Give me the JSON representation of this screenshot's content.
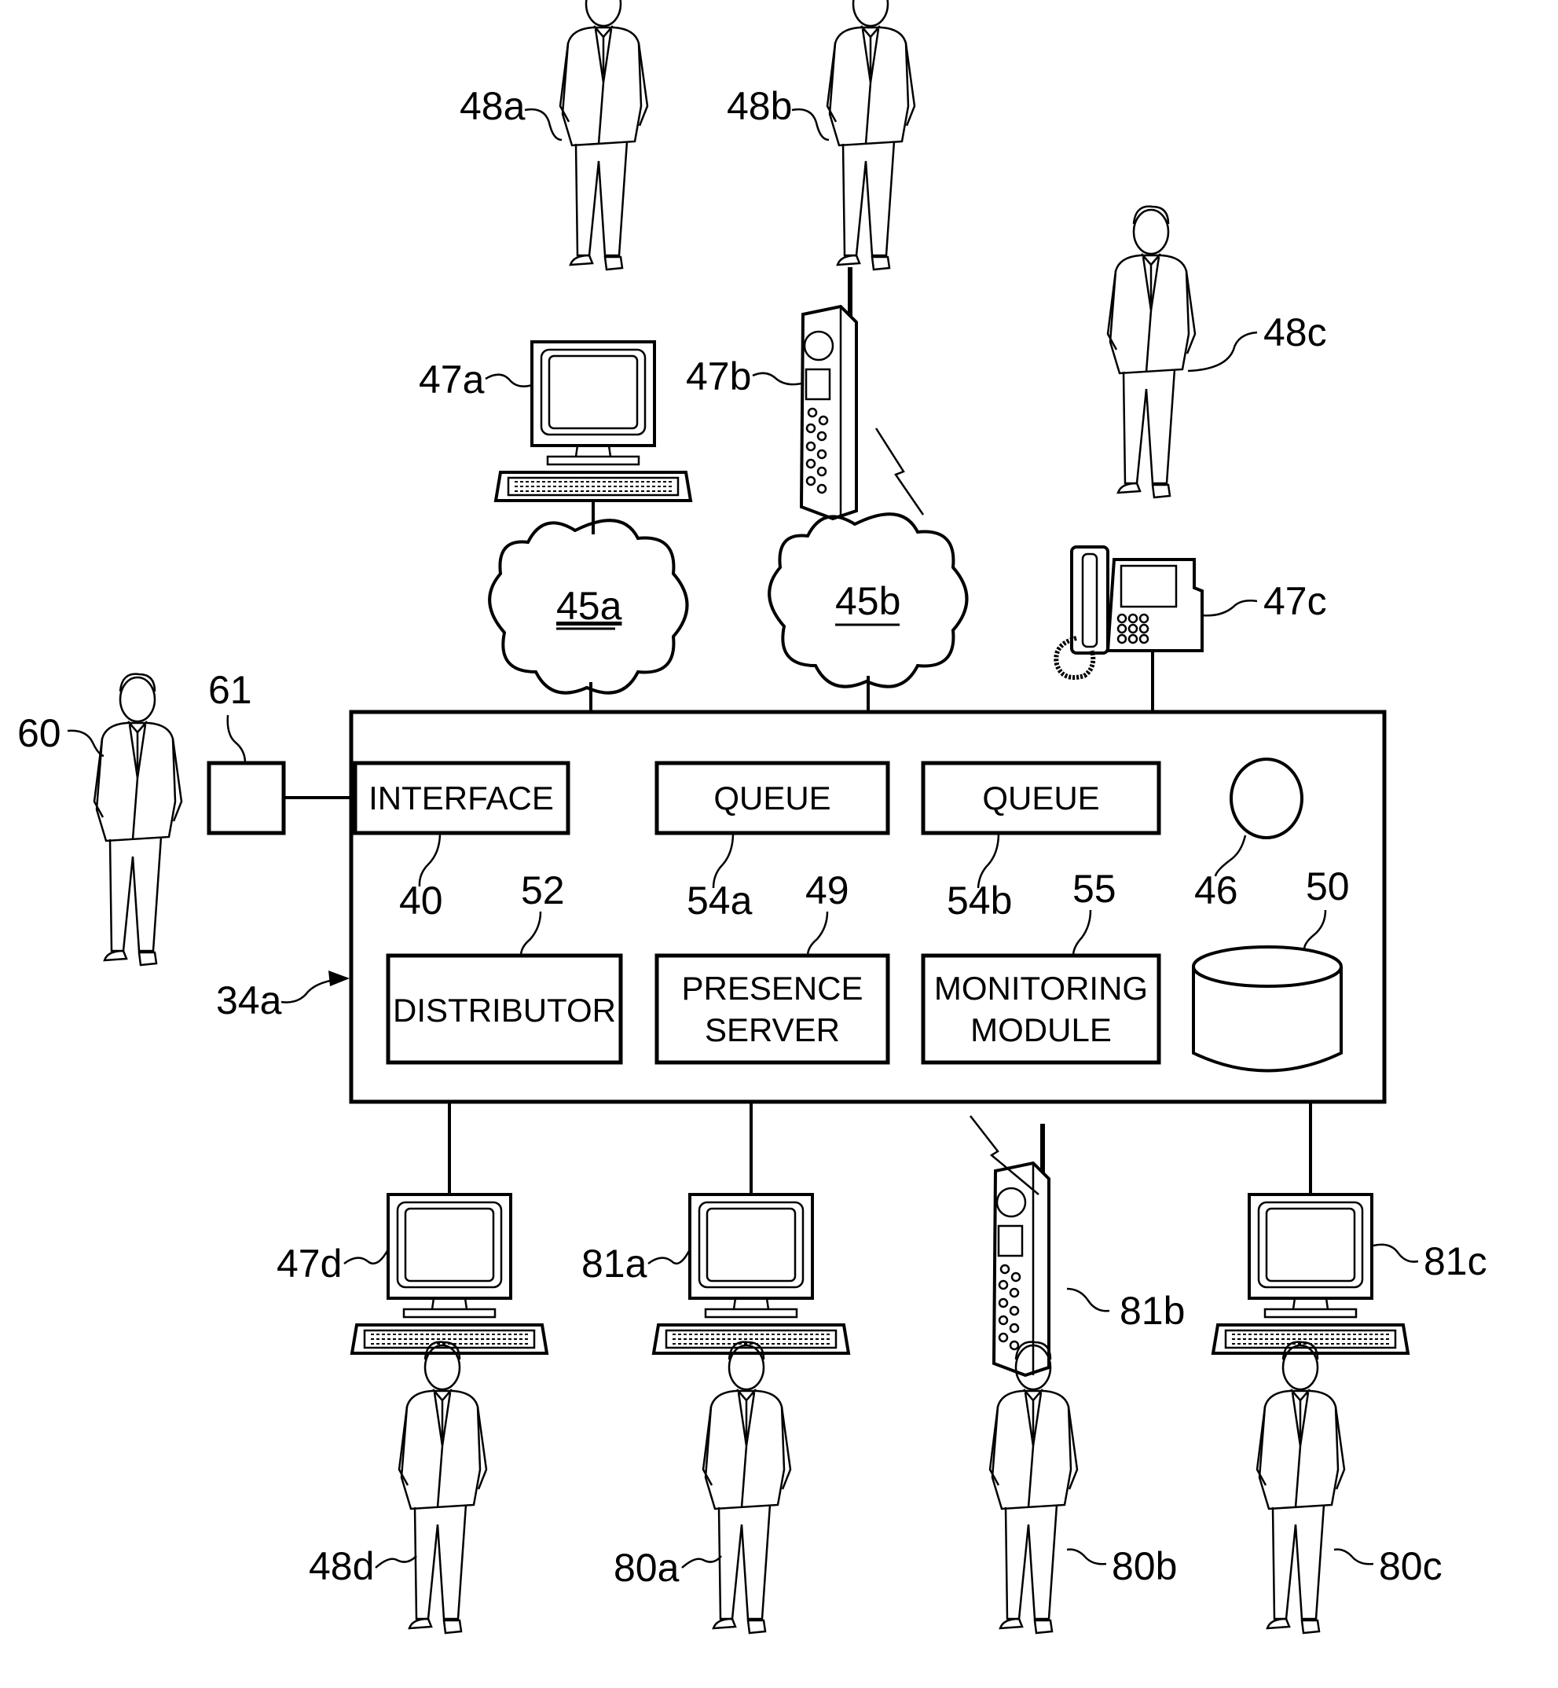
{
  "figure": {
    "system_label": "34a",
    "components": {
      "interface": {
        "ref": "40",
        "text": "INTERFACE"
      },
      "queue_a": {
        "ref": "54a",
        "text": "QUEUE"
      },
      "queue_b": {
        "ref": "54b",
        "text": "QUEUE"
      },
      "circle": {
        "ref": "46"
      },
      "distributor": {
        "ref": "52",
        "text": "DISTRIBUTOR"
      },
      "presence_server": {
        "ref": "49",
        "line1": "PRESENCE",
        "line2": "SERVER"
      },
      "monitoring_module": {
        "ref": "55",
        "line1": "MONITORING",
        "line2": "MODULE"
      },
      "database": {
        "ref": "50"
      }
    },
    "external": {
      "device_61": {
        "ref": "61"
      },
      "person_60": {
        "ref": "60"
      },
      "network_45a": {
        "ref": "45a"
      },
      "network_45b": {
        "ref": "45b"
      },
      "computer_47a": {
        "ref": "47a"
      },
      "mobile_47b": {
        "ref": "47b"
      },
      "phone_47c": {
        "ref": "47c"
      },
      "person_48a": {
        "ref": "48a"
      },
      "person_48b": {
        "ref": "48b"
      },
      "person_48c": {
        "ref": "48c"
      },
      "computer_47d": {
        "ref": "47d"
      },
      "computer_81a": {
        "ref": "81a"
      },
      "mobile_81b": {
        "ref": "81b"
      },
      "computer_81c": {
        "ref": "81c"
      },
      "person_48d": {
        "ref": "48d"
      },
      "person_80a": {
        "ref": "80a"
      },
      "person_80b": {
        "ref": "80b"
      },
      "person_80c": {
        "ref": "80c"
      }
    }
  }
}
